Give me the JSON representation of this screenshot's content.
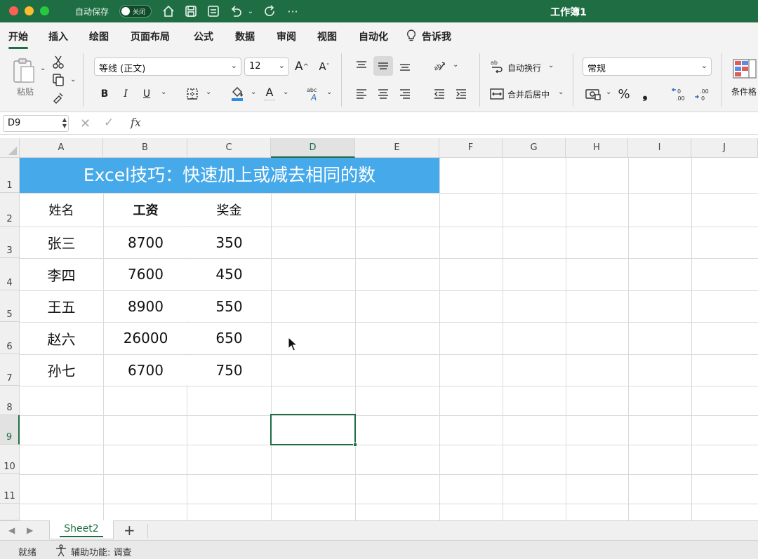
{
  "titlebar": {
    "autosave_label": "自动保存",
    "autosave_state": "关闭",
    "doc_title": "工作簿1"
  },
  "ribbon_tabs": [
    "开始",
    "插入",
    "绘图",
    "页面布局",
    "公式",
    "数据",
    "审阅",
    "视图",
    "自动化",
    "告诉我"
  ],
  "ribbon": {
    "paste_label": "粘贴",
    "font_name": "等线 (正文)",
    "font_size": "12",
    "bold": "B",
    "italic": "I",
    "underline": "U",
    "wrap_text": "自动换行",
    "merge_center": "合并后居中",
    "number_format": "常规",
    "percent": "%",
    "comma": "❟",
    "conditional_format": "条件格"
  },
  "formula_bar": {
    "name_box": "D9",
    "fx": "fx",
    "formula": ""
  },
  "sheet": {
    "columns": [
      "A",
      "B",
      "C",
      "D",
      "E",
      "F",
      "G",
      "H",
      "I",
      "J"
    ],
    "rows": [
      "1",
      "2",
      "3",
      "4",
      "5",
      "6",
      "7",
      "8",
      "9",
      "10",
      "11"
    ],
    "selected_cell": "D9",
    "title": "Excel技巧：快速加上或减去相同的数",
    "headers": [
      "姓名",
      "工资",
      "奖金"
    ],
    "data": [
      [
        "张三",
        "8700",
        "350"
      ],
      [
        "李四",
        "7600",
        "450"
      ],
      [
        "王五",
        "8900",
        "550"
      ],
      [
        "赵六",
        "26000",
        "650"
      ],
      [
        "孙七",
        "6700",
        "750"
      ]
    ]
  },
  "sheet_tabs": {
    "active": "Sheet2",
    "add": "+"
  },
  "status_bar": {
    "ready": "就绪",
    "accessibility": "辅助功能: 调查"
  },
  "colors": {
    "excel_green": "#1f6e43",
    "title_banner": "#45a9ea"
  }
}
